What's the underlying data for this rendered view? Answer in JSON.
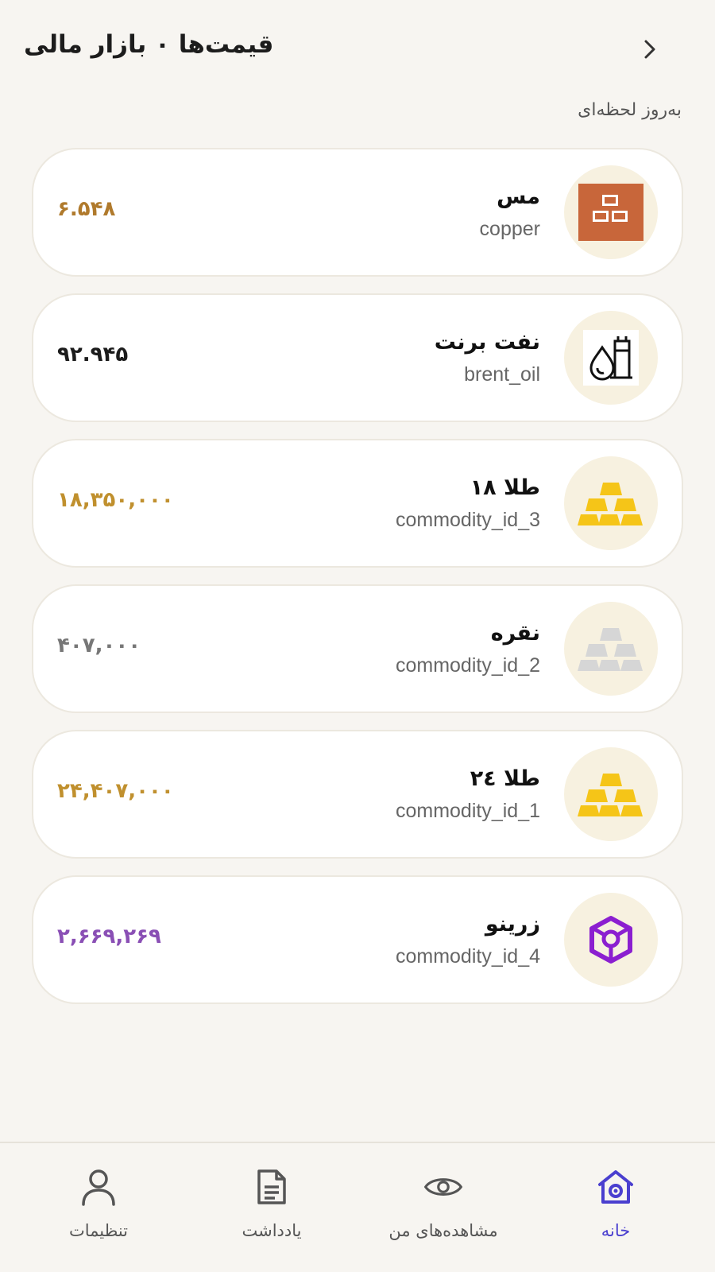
{
  "header": {
    "title": "قیمت‌ها ۰ بازار مالی",
    "back_icon": "chevron-right-icon",
    "subtitle": "به‌روز لحظه‌ای"
  },
  "items": [
    {
      "name": "مس",
      "id": "copper",
      "price": "۶.۵۴۸",
      "price_color": "#b07a2c",
      "icon": "copper-bars-icon"
    },
    {
      "name": "نفت برنت",
      "id": "brent_oil",
      "price": "۹۲.۹۴۵",
      "price_color": "#1c1c1c",
      "icon": "oil-drop-icon"
    },
    {
      "name": "طلا ۱۸",
      "id": "commodity_id_3",
      "price": "۱۸,۳۵۰,۰۰۰",
      "price_color": "#c0902e",
      "icon": "gold-bars-icon"
    },
    {
      "name": "نقره",
      "id": "commodity_id_2",
      "price": "۴۰۷,۰۰۰",
      "price_color": "#777777",
      "icon": "silver-bars-icon"
    },
    {
      "name": "طلا ۲٤",
      "id": "commodity_id_1",
      "price": "۲۴,۴۰۷,۰۰۰",
      "price_color": "#c0902e",
      "icon": "gold-bars-icon"
    },
    {
      "name": "زرینو",
      "id": "commodity_id_4",
      "price": "۲,۶۶۹,۲۶۹",
      "price_color": "#8a4fb5",
      "icon": "zarino-cube-icon"
    }
  ],
  "nav": {
    "home": {
      "label": "خانه",
      "icon": "home-icon",
      "active": true
    },
    "watchlist": {
      "label": "مشاهده‌های من",
      "icon": "eye-icon"
    },
    "notes": {
      "label": "یادداشت",
      "icon": "document-icon"
    },
    "settings": {
      "label": "تنظیمات",
      "icon": "user-icon"
    }
  },
  "colors": {
    "background": "#f7f5f1",
    "card": "#ffffff",
    "accent": "#4a3fcf",
    "gold": "#f5c518",
    "copper": "#c8663a",
    "zarino": "#8b1fd0"
  }
}
